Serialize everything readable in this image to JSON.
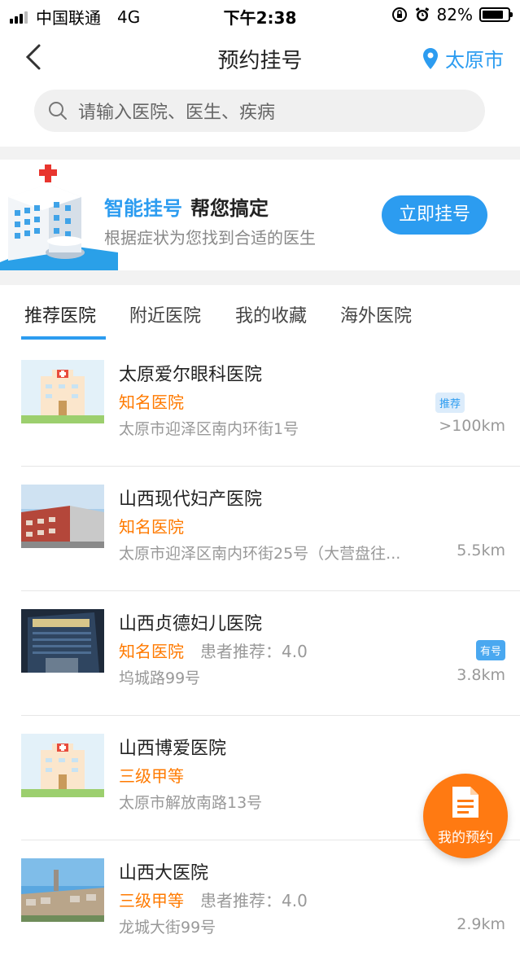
{
  "status_bar": {
    "carrier": "中国联通",
    "network": "4G",
    "time": "下午2:38",
    "battery": "82%",
    "battery_level": 0.82
  },
  "header": {
    "title": "预约挂号",
    "city": "太原市"
  },
  "search": {
    "placeholder": "请输入医院、医生、疾病"
  },
  "banner": {
    "title_highlight": "智能挂号",
    "title_rest": "帮您搞定",
    "subtitle": "根据症状为您找到合适的医生",
    "button": "立即挂号"
  },
  "tabs": [
    {
      "label": "推荐医院",
      "active": true
    },
    {
      "label": "附近医院",
      "active": false
    },
    {
      "label": "我的收藏",
      "active": false
    },
    {
      "label": "海外医院",
      "active": false
    }
  ],
  "hospitals": [
    {
      "name": "太原爱尔眼科医院",
      "level": "知名医院",
      "rating": "",
      "address": "太原市迎泽区南内环街1号",
      "distance": ">100km",
      "badge": "推荐"
    },
    {
      "name": "山西现代妇产医院",
      "level": "知名医院",
      "rating": "",
      "address": "太原市迎泽区南内环街25号（大营盘往...",
      "distance": "5.5km",
      "badge": ""
    },
    {
      "name": "山西贞德妇儿医院",
      "level": "知名医院",
      "rating": "患者推荐：4.0",
      "address": "坞城路99号",
      "distance": "3.8km",
      "badge": "有号"
    },
    {
      "name": "山西博爱医院",
      "level": "三级甲等",
      "rating": "",
      "address": "太原市解放南路13号",
      "distance": "",
      "badge": ""
    },
    {
      "name": "山西大医院",
      "level": "三级甲等",
      "rating": "患者推荐：4.0",
      "address": "龙城大街99号",
      "distance": "2.9km",
      "badge": ""
    }
  ],
  "fab": {
    "label": "我的预约"
  },
  "colors": {
    "accent": "#2c9cf0",
    "orange": "#ff7a00",
    "fab": "#ff7a12"
  }
}
